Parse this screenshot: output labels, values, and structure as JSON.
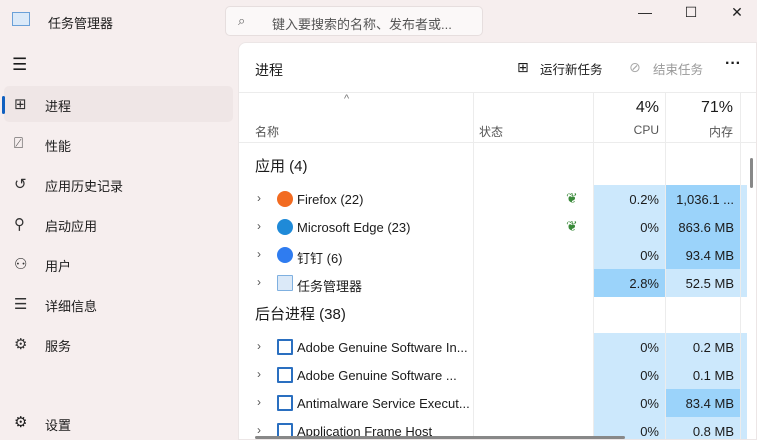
{
  "app": {
    "title": "任务管理器"
  },
  "search": {
    "placeholder": "键入要搜索的名称、发布者或..."
  },
  "window_controls": {
    "minimize": "—",
    "maximize": "☐",
    "close": "✕"
  },
  "nav": [
    {
      "label": "进程",
      "icon": "processes-icon",
      "glyph": "⊞",
      "selected": true
    },
    {
      "label": "性能",
      "icon": "performance-icon",
      "glyph": "⍁"
    },
    {
      "label": "应用历史记录",
      "icon": "history-icon",
      "glyph": "↺"
    },
    {
      "label": "启动应用",
      "icon": "startup-icon",
      "glyph": "⚲"
    },
    {
      "label": "用户",
      "icon": "users-icon",
      "glyph": "⚇"
    },
    {
      "label": "详细信息",
      "icon": "details-icon",
      "glyph": "☰"
    },
    {
      "label": "服务",
      "icon": "services-icon",
      "glyph": "⚙"
    }
  ],
  "settings": "设置",
  "panel": {
    "title": "进程",
    "run_task": "运行新任务",
    "end_task": "结束任务",
    "more": "···"
  },
  "columns": {
    "name": "名称",
    "status": "状态",
    "cpu_pct": "4%",
    "cpu": "CPU",
    "mem_pct": "71%",
    "mem": "内存"
  },
  "sections": [
    {
      "title": "应用 (4)",
      "rows": [
        {
          "name": "Firefox (22)",
          "icon": "firefox-icon",
          "color": "#f26b21",
          "cpu": "0.2%",
          "mem": "1,036.1 ...",
          "cpu_level": "l",
          "mem_level": "d",
          "eco": true
        },
        {
          "name": "Microsoft Edge (23)",
          "icon": "edge-icon",
          "color": "#1f8ad8",
          "cpu": "0%",
          "mem": "863.6 MB",
          "cpu_level": "l",
          "mem_level": "d",
          "eco": true
        },
        {
          "name": "钉钉 (6)",
          "icon": "dingtalk-icon",
          "color": "#2f7cf0",
          "cpu": "0%",
          "mem": "93.4 MB",
          "cpu_level": "l",
          "mem_level": "d"
        },
        {
          "name": "任务管理器",
          "icon": "task-manager-icon",
          "color": "#7fb0e0",
          "cpu": "2.8%",
          "mem": "52.5 MB",
          "cpu_level": "d",
          "mem_level": "l"
        }
      ]
    },
    {
      "title": "后台进程 (38)",
      "rows": [
        {
          "name": "Adobe Genuine Software In...",
          "icon": "app-window-icon",
          "color": "#2a6fc0",
          "cpu": "0%",
          "mem": "0.2 MB",
          "cpu_level": "l",
          "mem_level": "l"
        },
        {
          "name": "Adobe Genuine Software ...",
          "icon": "app-window-icon",
          "color": "#2a6fc0",
          "cpu": "0%",
          "mem": "0.1 MB",
          "cpu_level": "l",
          "mem_level": "l"
        },
        {
          "name": "Antimalware Service Execut...",
          "icon": "app-window-icon",
          "color": "#2a6fc0",
          "cpu": "0%",
          "mem": "83.4 MB",
          "cpu_level": "l",
          "mem_level": "d"
        },
        {
          "name": "Application Frame Host",
          "icon": "app-window-icon",
          "color": "#2a6fc0",
          "cpu": "0%",
          "mem": "0.8 MB",
          "cpu_level": "l",
          "mem_level": "l"
        }
      ]
    }
  ]
}
